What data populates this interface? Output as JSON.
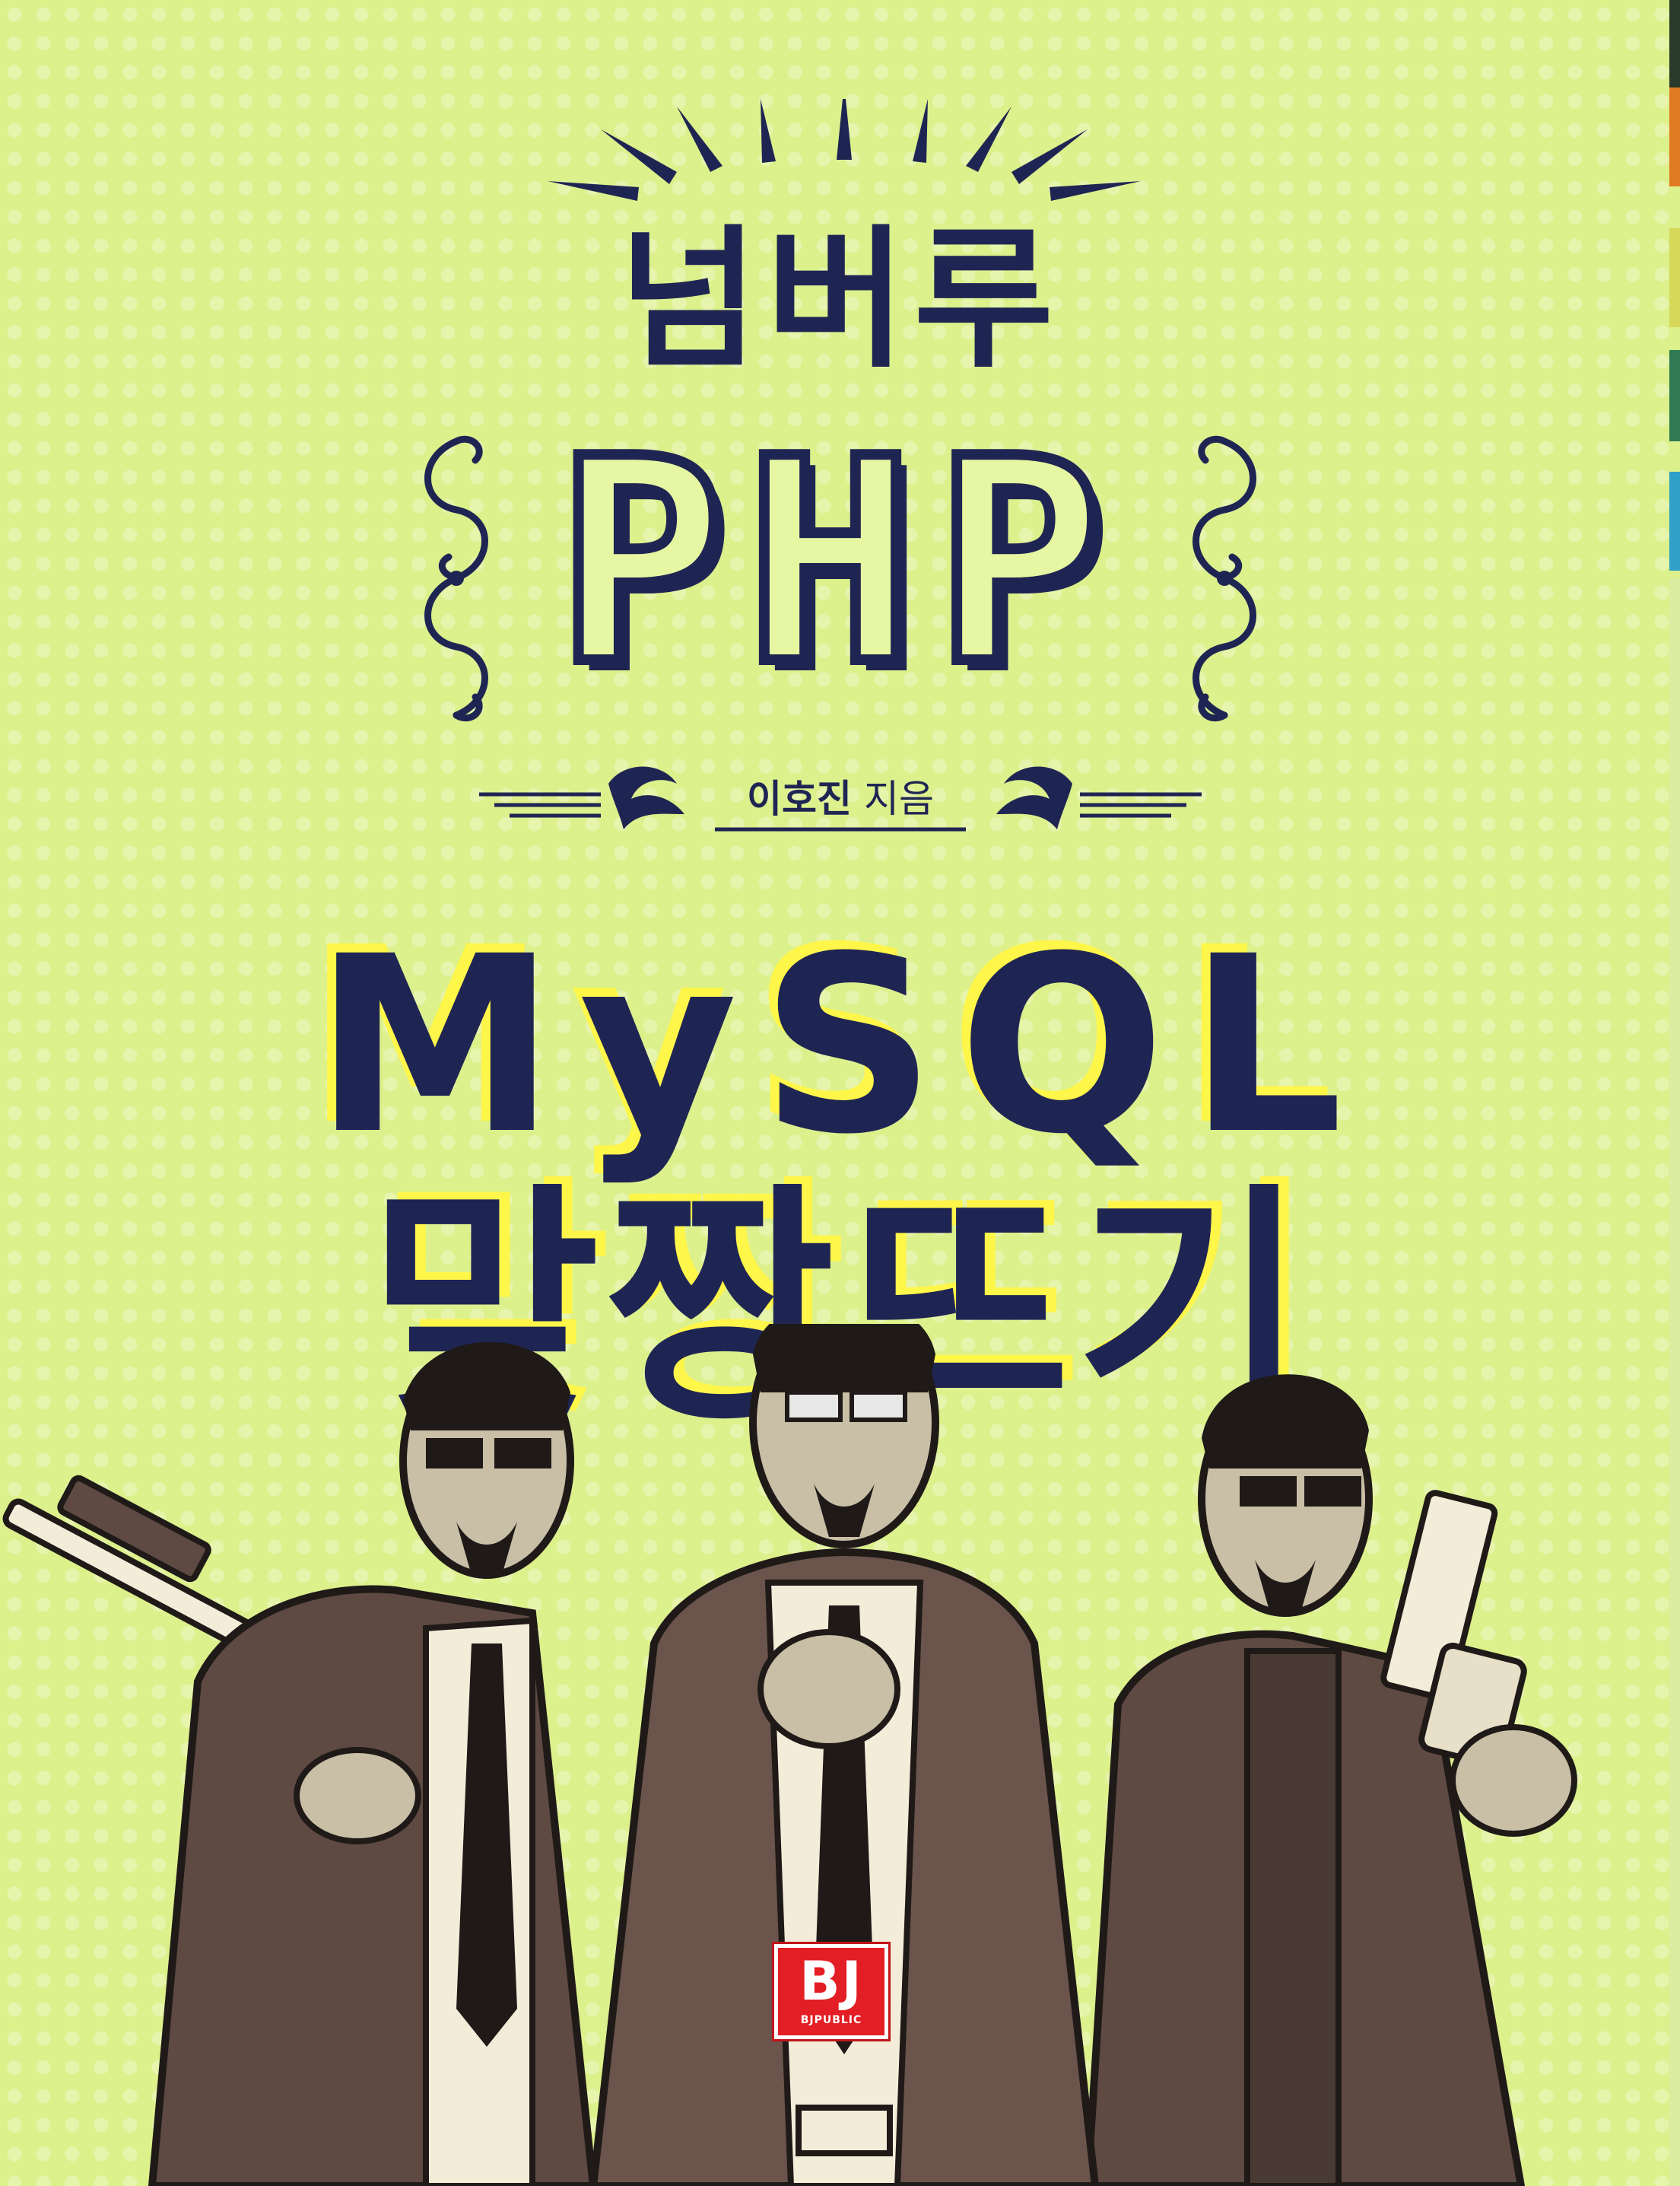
{
  "cover": {
    "title_line1": "넘버루",
    "title_line2": "PHP",
    "author_name": "이호진",
    "author_suffix": " 지음",
    "title_line3": "MySQL",
    "title_line4": "맞짱뜨기",
    "publisher_mark": "BJ",
    "publisher_name": "BJPUBLIC"
  },
  "colors": {
    "background": "#dcf08c",
    "ink_navy": "#1f2553",
    "highlight_yellow": "#fff64a",
    "coat_brown": "#5e4a42",
    "shirt_cream": "#f3ecd9",
    "logo_red": "#e31e24"
  },
  "icons": [
    "sunburst-icon",
    "scroll-ornament-icon",
    "leaf-ornament-icon",
    "bj-logo"
  ]
}
